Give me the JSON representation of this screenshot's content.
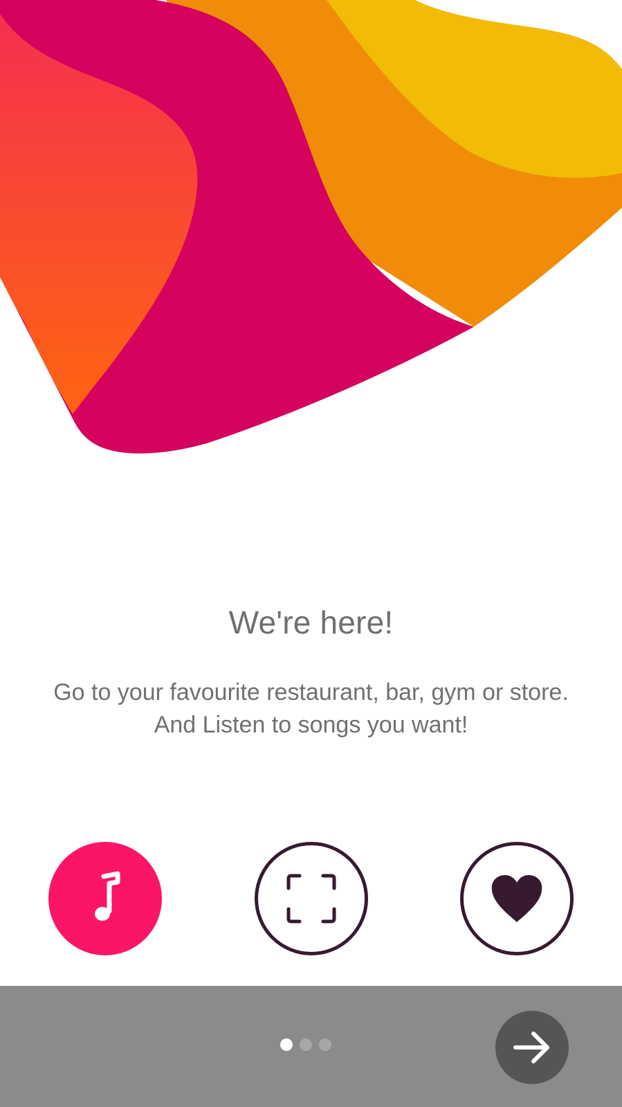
{
  "onboarding": {
    "title": "We're here!",
    "description": "Go to your favourite restaurant, bar, gym or store. And Listen to songs you want!"
  },
  "features": [
    {
      "icon": "music-note-icon",
      "style": "filled",
      "color": "#fc1468"
    },
    {
      "icon": "scan-frame-icon",
      "style": "outlined",
      "color": "#361a30"
    },
    {
      "icon": "heart-icon",
      "style": "outlined",
      "color": "#361a30"
    }
  ],
  "pagination": {
    "total_pages": 3,
    "current_page": 1
  },
  "navigation": {
    "next_icon": "arrow-right-icon"
  },
  "colors": {
    "magenta": "#d5025e",
    "orange": "#f08c07",
    "yellow": "#f1bb08",
    "coral_top": "#f43050",
    "coral_bottom": "#ff6410",
    "bottom_bar": "#8b8b8b",
    "next_button": "#555555"
  }
}
